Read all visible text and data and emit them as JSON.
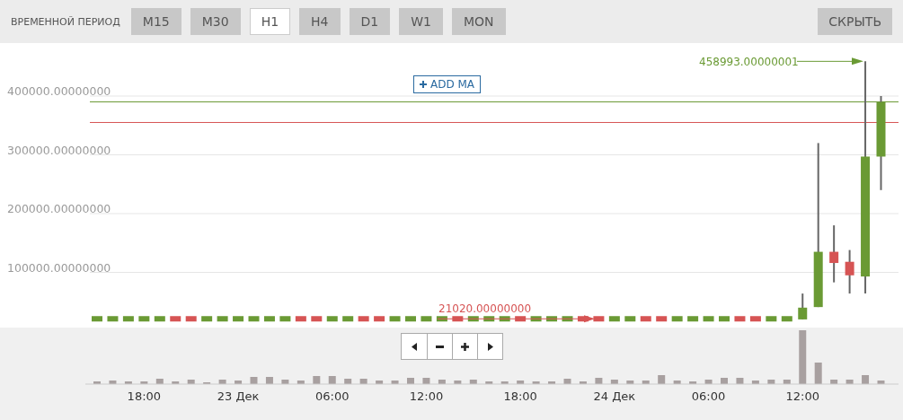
{
  "toolbar": {
    "label": "ВРЕМЕННОЙ ПЕРИОД",
    "timeframes": [
      {
        "label": "M15",
        "selected": false
      },
      {
        "label": "M30",
        "selected": false
      },
      {
        "label": "H1",
        "selected": true
      },
      {
        "label": "H4",
        "selected": false
      },
      {
        "label": "D1",
        "selected": false
      },
      {
        "label": "W1",
        "selected": false
      },
      {
        "label": "MON",
        "selected": false
      }
    ],
    "hide_button": "СКРЫТЬ"
  },
  "chart": {
    "add_ma_button": "ADD MA",
    "y_axis_labels": [
      "400000.00000000",
      "300000.00000000",
      "200000.00000000",
      "100000.00000000"
    ],
    "high_label": "458993.00000001",
    "low_label": "21020.00000000"
  },
  "navigator": {
    "x_axis_labels": [
      "18:00",
      "23 Дек",
      "06:00",
      "12:00",
      "18:00",
      "24 Дек",
      "06:00",
      "12:00"
    ]
  }
}
